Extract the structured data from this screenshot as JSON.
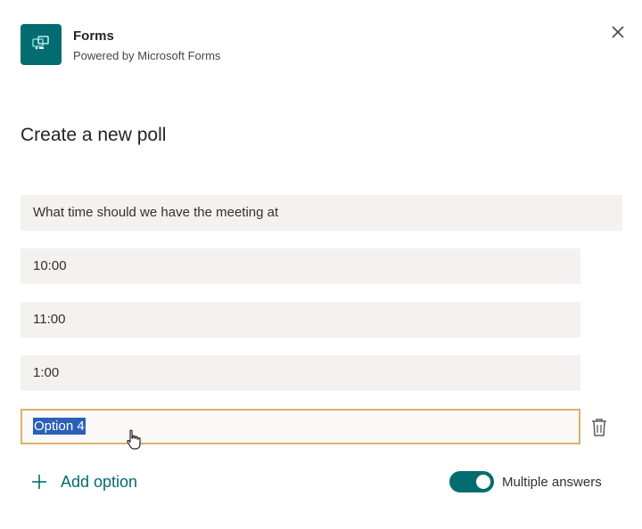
{
  "header": {
    "app_name": "Forms",
    "app_subtitle": "Powered by Microsoft Forms",
    "brand_color": "#036c70",
    "icon": "forms-app-icon",
    "close_icon": "close-icon"
  },
  "poll": {
    "title": "Create a new poll",
    "question": "What time should we have the meeting at",
    "options": [
      "10:00",
      "11:00",
      "1:00"
    ],
    "active_option": "Option 4",
    "active_option_selected": true,
    "delete_icon": "trash-icon"
  },
  "footer": {
    "add_option_label": "Add option",
    "add_icon": "plus-icon",
    "multiple_answers_label": "Multiple answers",
    "multiple_answers_enabled": true
  },
  "colors": {
    "accent": "#036c70",
    "field_bg": "#f3f2f1",
    "focus_border": "#d8b26b",
    "selection": "#2b5fb8"
  }
}
